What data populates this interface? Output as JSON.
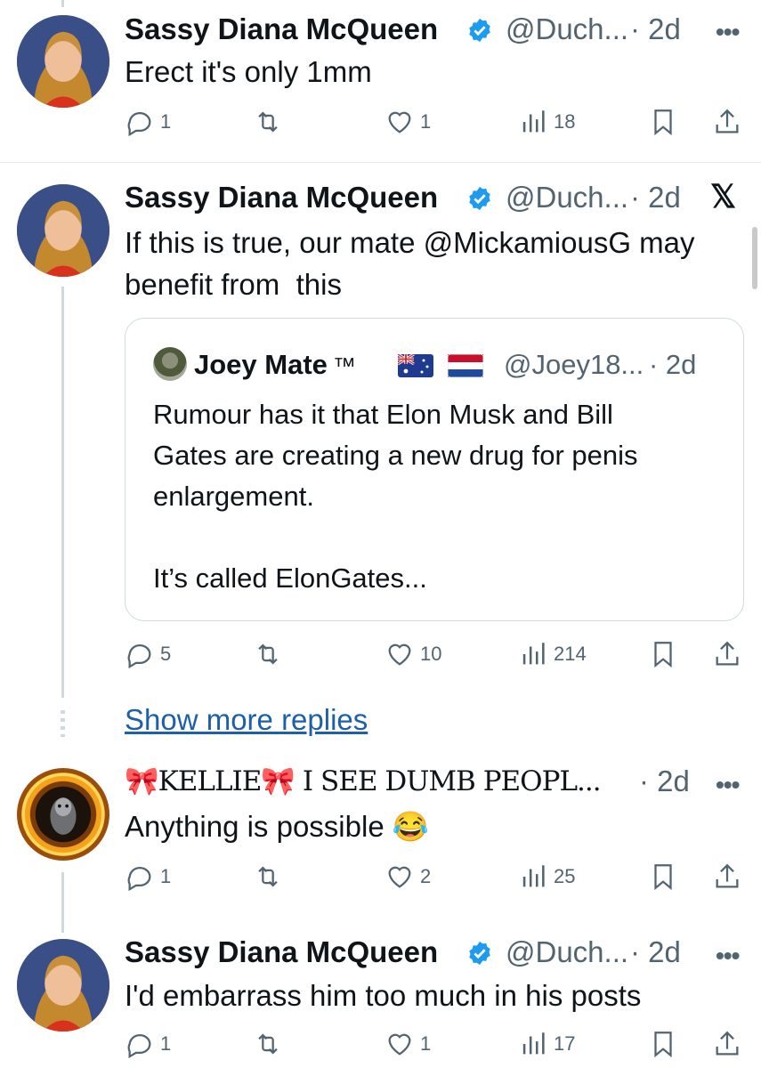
{
  "colors": {
    "text": "#0f1419",
    "secondary": "#536471",
    "verified": "#1d9bf0",
    "link": "#1d5fa8"
  },
  "tweets": [
    {
      "name": "Sassy Diana McQueen",
      "handle": "@Duch...",
      "dot_time": "· 2d",
      "text": "Erect it's only 1mm",
      "replies": "1",
      "retweets": "",
      "likes": "1",
      "views": "18",
      "more_label": "•••"
    },
    {
      "name": "Sassy Diana McQueen",
      "handle": "@Duch...",
      "dot_time": "· 2d",
      "text": "If this is true, our mate @MickamiousG may\nbenefit from  this",
      "replies": "5",
      "retweets": "",
      "likes": "10",
      "views": "214",
      "corner_icon": "x-logo-icon",
      "quote": {
        "name": "Joey Mate",
        "tm": "™",
        "flags": [
          "australia-flag-icon",
          "netherlands-flag-icon"
        ],
        "handle": "@Joey18...",
        "dot_time": "· 2d",
        "text": "Rumour has it that Elon Musk and Bill\nGates are creating a new drug for penis\nenlargement.\n\nIt’s called ElonGates..."
      }
    },
    {
      "name": "🎀KELLIE🎀 I SEE DUMB PEOPL...",
      "handle": "",
      "dot_time": "· 2d",
      "text": "Anything is possible 😂",
      "replies": "1",
      "retweets": "",
      "likes": "2",
      "views": "25",
      "more_label": "•••"
    },
    {
      "name": "Sassy Diana McQueen",
      "handle": "@Duch...",
      "dot_time": "· 2d",
      "text": "I'd embarrass him too much in his posts",
      "replies": "1",
      "retweets": "",
      "likes": "1",
      "views": "17",
      "more_label": "•••"
    }
  ],
  "show_more_replies": "Show more replies",
  "corner_x": "𝕏"
}
